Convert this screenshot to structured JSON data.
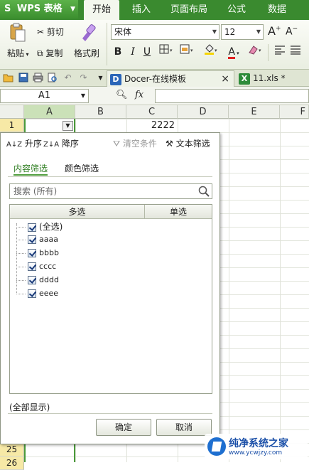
{
  "app": {
    "name": "WPS 表格",
    "logo_char": "S",
    "accent": "#3a8a2f"
  },
  "menu": [
    "开始",
    "插入",
    "页面布局",
    "公式",
    "数据"
  ],
  "ribbon": {
    "paste": "粘贴",
    "cut": "剪切",
    "copy": "复制",
    "format_painter": "格式刷",
    "font_name": "宋体",
    "font_size": "12",
    "grow_font": "A",
    "shrink_font": "A",
    "bold": "B",
    "italic": "I",
    "underline": "U",
    "font_color_letter": "A"
  },
  "tabs": {
    "docer": "Docer-在线模板",
    "close": "×",
    "xls": "11.xls *"
  },
  "formula_bar": {
    "cell_ref": "A1",
    "fx": "fx"
  },
  "grid": {
    "columns": [
      "A",
      "B",
      "C",
      "D",
      "E",
      "F"
    ],
    "rows": [
      "1",
      "25",
      "26"
    ],
    "cell_C1": "2222"
  },
  "filter": {
    "sort_asc": "升序",
    "sort_desc": "降序",
    "clear": "清空条件",
    "text_filter": "文本筛选",
    "tab_content": "内容筛选",
    "tab_color": "颜色筛选",
    "search_placeholder": "搜索 (所有)",
    "col_multi": "多选",
    "col_single": "单选",
    "items": [
      "(全选)",
      "aaaa",
      "bbbb",
      "cccc",
      "dddd",
      "eeee"
    ],
    "show_all": "(全部显示)",
    "ok": "确定",
    "cancel": "取消"
  },
  "watermark": {
    "title": "纯净系统之家",
    "url": "www.ycwjzy.com"
  }
}
